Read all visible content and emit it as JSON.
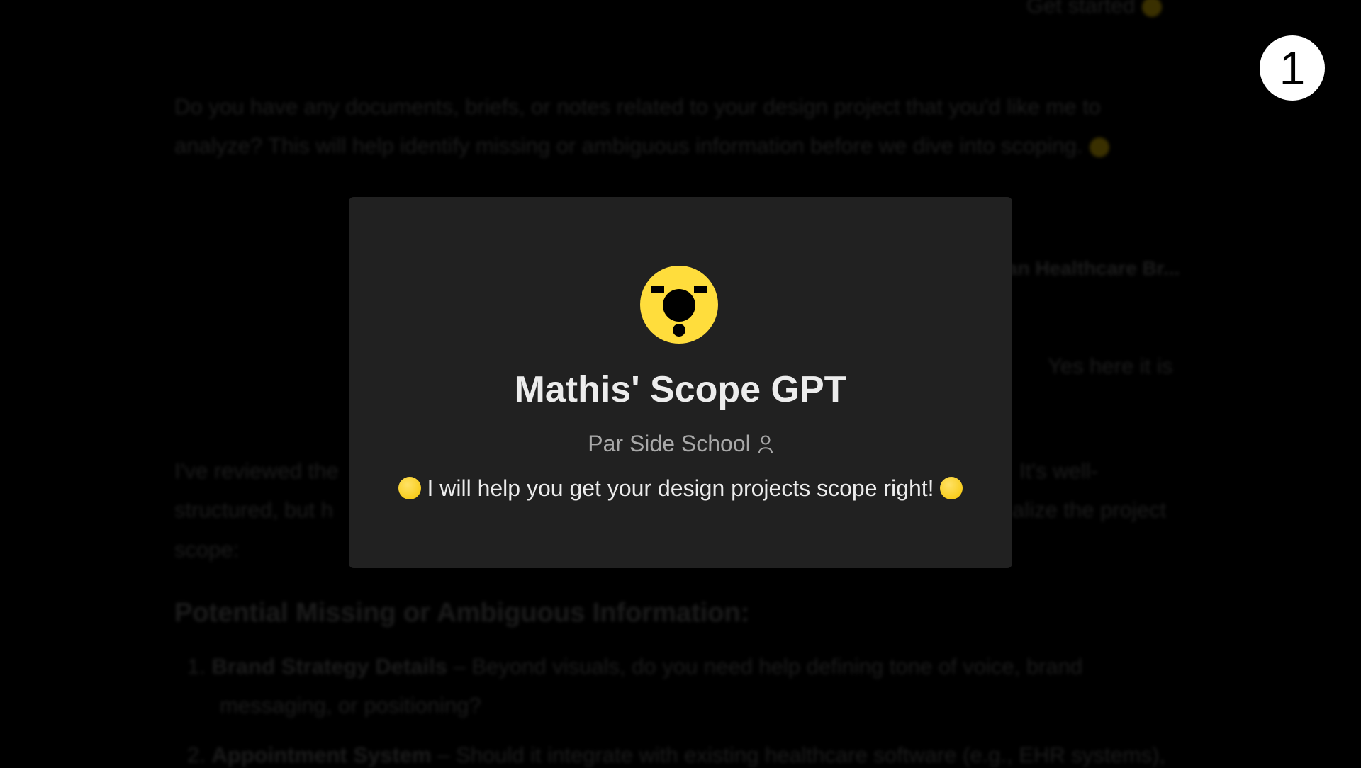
{
  "background_chat": {
    "top_button": "Get started",
    "assistant_message_1": [
      "Do you have any documents, briefs, or notes related to your design project that you'd like me to",
      "analyze? This will help identify missing or ambiguous information before we dive into scoping."
    ],
    "attachment_title": "an Healthcare Br...",
    "user_message": "Yes here it is",
    "assistant_message_2": {
      "line1_left": "I've reviewed the",
      "line1_right": "It's well-",
      "line2_left": "structured, but h",
      "line2_right": "alize the project",
      "line3": "scope:"
    },
    "heading": "Potential Missing or Ambiguous Information:",
    "list": [
      {
        "num": "1.",
        "bold": "Brand Strategy Details",
        "text": " – Beyond visuals, do you need help defining tone of voice, brand",
        "cont": "messaging, or positioning?"
      },
      {
        "num": "2.",
        "bold": "Appointment System",
        "text": " – Should it integrate with existing healthcare software (e.g., EHR systems),"
      }
    ]
  },
  "modal": {
    "title": "Mathis' Scope GPT",
    "author": "Par Side School",
    "description": "I will help you get your design projects scope right!",
    "logo_color": "#FFDD3C"
  },
  "step_badge": "1"
}
